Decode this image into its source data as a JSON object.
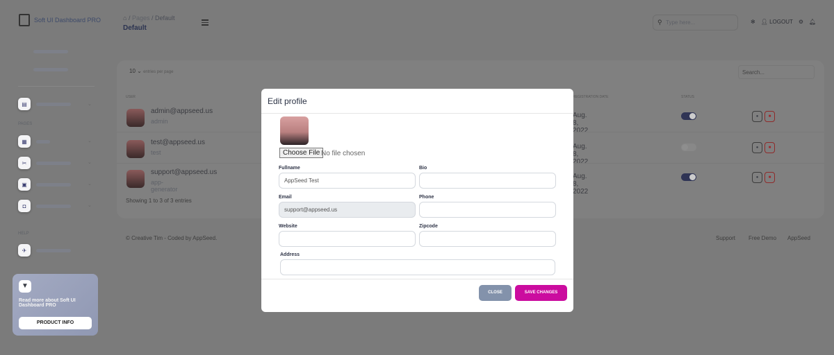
{
  "brand": "Soft UI Dashboard PRO",
  "breadcrumb": {
    "root_icon": "home-icon",
    "pages": "Pages",
    "current": "Default"
  },
  "page_title": "Default",
  "topbar": {
    "search_placeholder": "Type here...",
    "logout": "LOGOUT"
  },
  "sidebar": {
    "section_pages": "PAGES",
    "section_help": "HELP",
    "promo_text": "Read more about Soft UI Dashboard PRO",
    "promo_button": "PRODUCT INFO"
  },
  "table": {
    "entries_value": "10",
    "entries_label": "entries per page",
    "search_placeholder": "Search...",
    "headers": [
      "USER",
      "REGISTRATION DATE",
      "STATUS"
    ],
    "rows": [
      {
        "email": "admin@appseed.us",
        "username": "admin",
        "date": "Aug. 8, 2022",
        "status": true
      },
      {
        "email": "test@appseed.us",
        "username": "test",
        "date": "Aug. 8, 2022",
        "status": false
      },
      {
        "email": "support@appseed.us",
        "username": "app-generator",
        "date": "Aug. 8, 2022",
        "status": true
      }
    ],
    "footer_info": "Showing 1 to 3 of 3 entries"
  },
  "footer": {
    "copyright": "© Creative Tim - Coded by AppSeed.",
    "links": [
      "Support",
      "Free Demo",
      "AppSeed"
    ]
  },
  "modal": {
    "title": "Edit profile",
    "choose_file": "Choose File",
    "no_file": "No file chosen",
    "fields": {
      "fullname": {
        "label": "Fullname",
        "value": "AppSeed Test"
      },
      "bio": {
        "label": "Bio",
        "value": ""
      },
      "email": {
        "label": "Email",
        "value": "support@appseed.us"
      },
      "phone": {
        "label": "Phone",
        "value": ""
      },
      "website": {
        "label": "Website",
        "value": ""
      },
      "zipcode": {
        "label": "Zipcode",
        "value": ""
      },
      "address": {
        "label": "Address",
        "value": ""
      }
    },
    "close": "CLOSE",
    "save": "SAVE CHANGES"
  },
  "colors": {
    "accent": "#cb0c9f",
    "close_button": "#8392ab",
    "toggle_on": "#2f3455"
  }
}
